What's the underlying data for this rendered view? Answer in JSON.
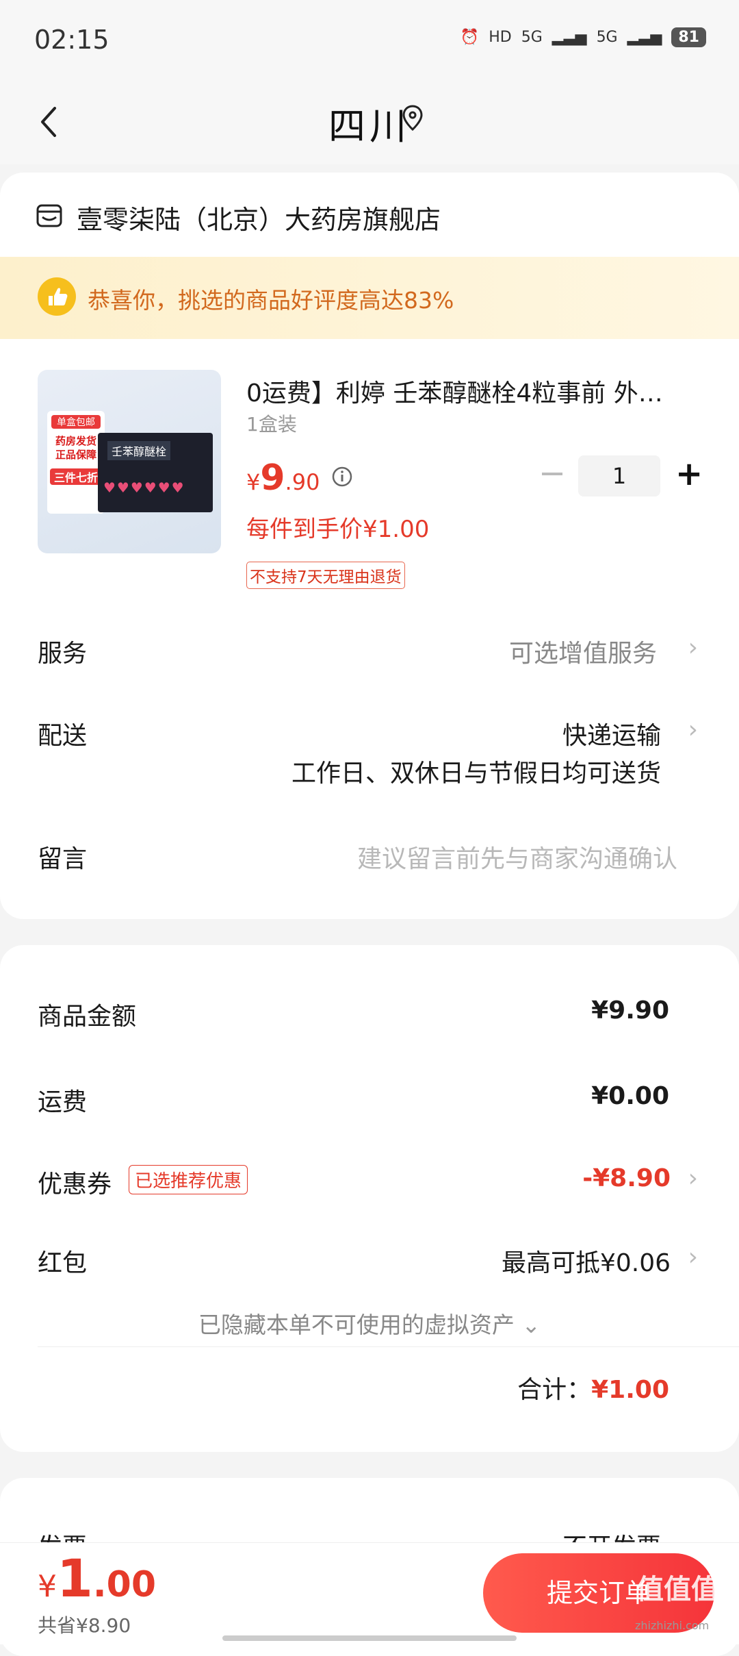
{
  "status_bar": {
    "time": "02:15",
    "indicators": [
      "HD",
      "5G",
      "5G"
    ],
    "battery": "81"
  },
  "header": {
    "title": "四川"
  },
  "store": {
    "name": "壹零柒陆（北京）大药房旗舰店"
  },
  "banner": {
    "text": "恭喜你，挑选的商品好评度高达83%"
  },
  "product": {
    "image_labels": {
      "tag1": "单盒包邮",
      "tag2": "药房发货 正品保障",
      "tag3": "三件七折",
      "box_title": "壬苯醇醚栓"
    },
    "name": "0运费】利婷 壬苯醇醚栓4粒事前 外…",
    "spec": "1盒装",
    "price_currency": "¥",
    "price_integer": "9",
    "price_decimal": ".90",
    "quantity": "1",
    "per_item_price": "每件到手价¥1.00",
    "return_policy": "不支持7天无理由退货"
  },
  "service": {
    "label": "服务",
    "value": "可选增值服务"
  },
  "delivery": {
    "label": "配送",
    "value": "快递运输",
    "note": "工作日、双休日与节假日均可送货"
  },
  "message": {
    "label": "留言",
    "placeholder": "建议留言前先与商家沟通确认"
  },
  "summary": {
    "goods_amount": {
      "label": "商品金额",
      "value": "¥9.90"
    },
    "shipping": {
      "label": "运费",
      "value": "¥0.00"
    },
    "coupon": {
      "label": "优惠券",
      "tag": "已选推荐优惠",
      "value": "-¥8.90"
    },
    "red_packet": {
      "label": "红包",
      "value": "最高可抵¥0.06"
    },
    "hidden_assets": "已隐藏本单不可使用的虚拟资产",
    "total_label": "合计：",
    "total_value": "¥1.00"
  },
  "invoice": {
    "label": "发票",
    "value": "不开发票"
  },
  "bottom_bar": {
    "price_currency": "¥",
    "price_integer": "1",
    "price_decimal": ".00",
    "saved": "共省¥8.90",
    "submit_label": "提交订单",
    "watermark": "值值值",
    "watermark_sub": "zhizhizhi.com"
  },
  "colors": {
    "accent_red": "#e53a2a",
    "banner_bg": "#fdf0cc",
    "banner_text": "#d2691e"
  }
}
